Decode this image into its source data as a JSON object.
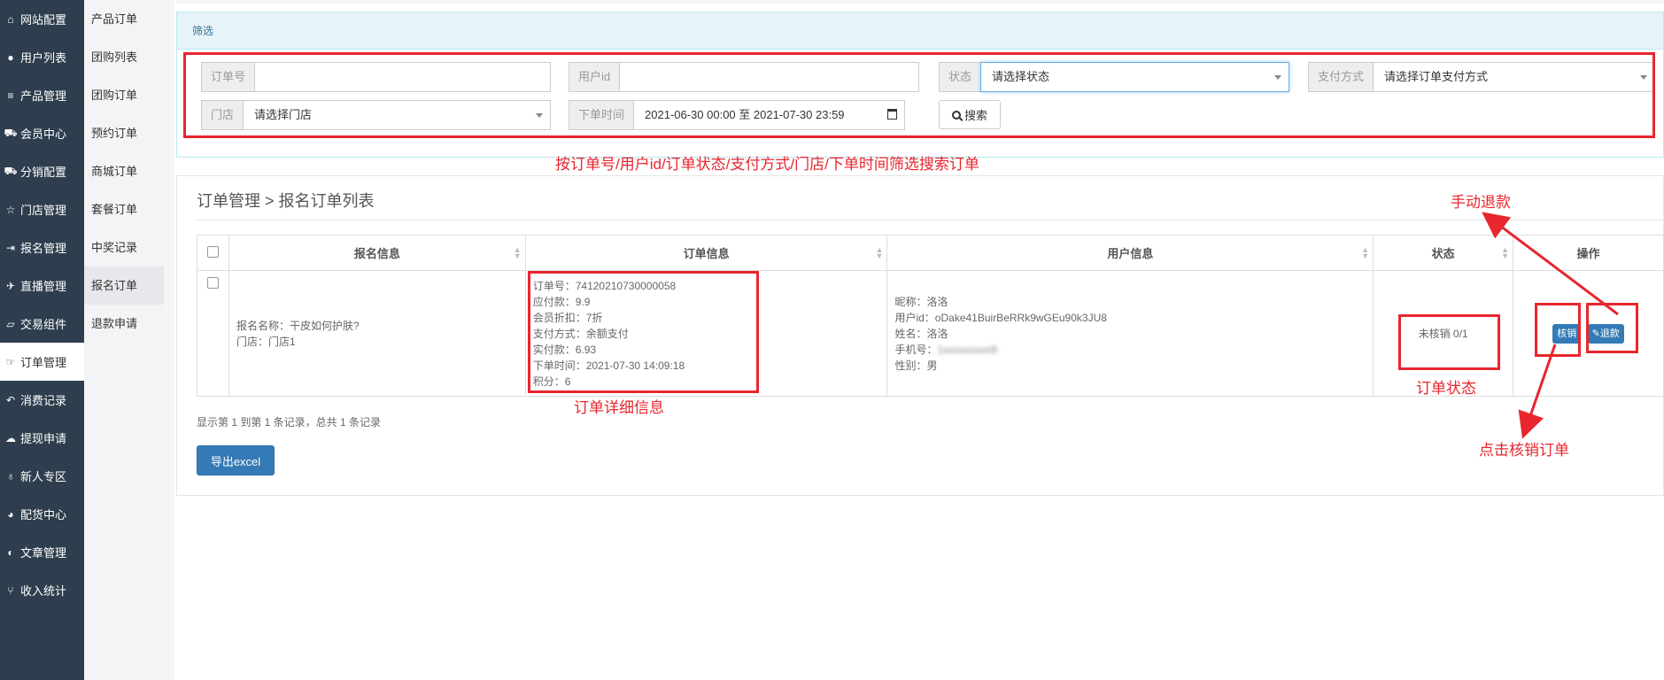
{
  "sidebar": {
    "items": [
      {
        "label": "网站配置",
        "icon": "home-icon"
      },
      {
        "label": "用户列表",
        "icon": "user-icon"
      },
      {
        "label": "产品管理",
        "icon": "list-icon"
      },
      {
        "label": "会员中心",
        "icon": "cart-icon"
      },
      {
        "label": "分销配置",
        "icon": "cart-icon"
      },
      {
        "label": "门店管理",
        "icon": "star-icon"
      },
      {
        "label": "报名管理",
        "icon": "signin-icon"
      },
      {
        "label": "直播管理",
        "icon": "plane-icon"
      },
      {
        "label": "交易组件",
        "icon": "eraser-icon"
      },
      {
        "label": "订单管理",
        "icon": "hand-icon"
      },
      {
        "label": "消费记录",
        "icon": "undo-icon"
      },
      {
        "label": "提现申请",
        "icon": "wechat-icon"
      },
      {
        "label": "新人专区",
        "icon": "map-pin-icon"
      },
      {
        "label": "配货中心",
        "icon": "pie-chart-icon"
      },
      {
        "label": "文章管理",
        "icon": "contrast-icon"
      },
      {
        "label": "收入统计",
        "icon": "branch-icon"
      }
    ],
    "active_index": 9
  },
  "submenu": {
    "items": [
      "产品订单",
      "团购列表",
      "团购订单",
      "预约订单",
      "商城订单",
      "套餐订单",
      "中奖记录",
      "报名订单",
      "退款申请"
    ],
    "active_index": 7
  },
  "filter": {
    "title": "筛选",
    "order_no": {
      "label": "订单号",
      "value": ""
    },
    "user_id": {
      "label": "用户id",
      "value": ""
    },
    "status": {
      "label": "状态",
      "value": "请选择状态"
    },
    "pay_method": {
      "label": "支付方式",
      "value": "请选择订单支付方式"
    },
    "store": {
      "label": "门店",
      "value": "请选择门店"
    },
    "order_time": {
      "label": "下单时间",
      "value": "2021-06-30 00:00 至 2021-07-30 23:59"
    },
    "search_label": "搜索"
  },
  "breadcrumb": "订单管理 > 报名订单列表",
  "table": {
    "headers": [
      "报名信息",
      "订单信息",
      "用户信息",
      "状态",
      "操作"
    ],
    "row": {
      "signup": [
        "报名名称：干皮如何护肤?",
        "门店：门店1"
      ],
      "order": [
        "订单号：74120210730000058",
        "应付款：9.9",
        "会员折扣：7折",
        "支付方式：余额支付",
        "实付款：6.93",
        "下单时间：2021-07-30 14:09:18",
        "积分：6"
      ],
      "user": {
        "nickname": "昵称：洛洛",
        "user_id": "用户id：oDake41BuirBeRRk9wGEu90k3JU8",
        "name": "姓名：洛洛",
        "phone_label": "手机号：",
        "phone_value": "1xxxxxxxxx9",
        "gender": "性别：男"
      },
      "status": "未核销 0/1",
      "actions": {
        "verify": "核销",
        "refund": "退款"
      }
    }
  },
  "footer": {
    "info": "显示第 1 到第 1 条记录，总共 1 条记录",
    "export_label": "导出excel"
  },
  "annotations": {
    "filter_note": "按订单号/用户id/订单状态/支付方式/门店/下单时间筛选搜索订单",
    "refund_note": "手动退款",
    "order_detail_note": "订单详细信息",
    "status_note": "订单状态",
    "verify_note": "点击核销订单"
  },
  "colors": {
    "sidebar_bg": "#2e3e4e",
    "annotation_red": "#e8262e",
    "primary_blue": "#337ab7"
  }
}
